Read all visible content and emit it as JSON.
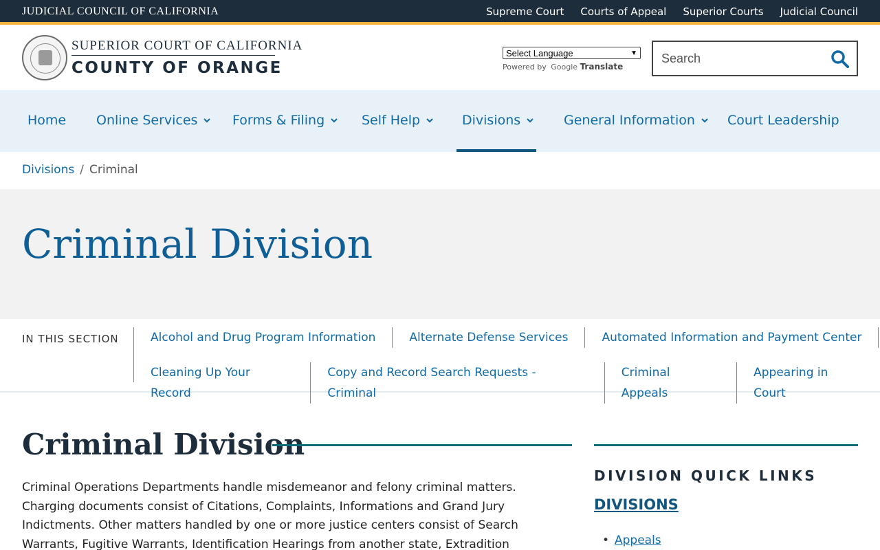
{
  "topbar": {
    "title": "JUDICIAL COUNCIL OF CALIFORNIA",
    "links": [
      "Supreme Court",
      "Courts of Appeal",
      "Superior Courts",
      "Judicial Council"
    ]
  },
  "header": {
    "brand_top": "SUPERIOR COURT OF CALIFORNIA",
    "brand_bottom": "COUNTY OF ORANGE",
    "language_select": "Select Language",
    "powered_by": "Powered by",
    "google": "Google",
    "translate": "Translate",
    "search_placeholder": "Search"
  },
  "nav": {
    "items": [
      {
        "label": "Home"
      },
      {
        "label": "Online Services"
      },
      {
        "label": "Forms & Filing"
      },
      {
        "label": "Self Help"
      },
      {
        "label": "Divisions"
      },
      {
        "label": "General Information"
      },
      {
        "label": "Court Leadership"
      }
    ],
    "active": "Divisions"
  },
  "breadcrumb": {
    "parent": "Divisions",
    "separator": "/",
    "current": "Criminal"
  },
  "hero": {
    "title": "Criminal Division"
  },
  "in_this_section": {
    "label": "IN THIS SECTION",
    "row1": [
      "Alcohol and Drug Program Information",
      "Alternate Defense Services",
      "Automated Information and Payment Center"
    ],
    "row2": [
      "Cleaning Up Your Record",
      "Copy and Record Search Requests - Criminal",
      "Criminal Appeals",
      "Appearing in Court"
    ]
  },
  "content": {
    "title": "Criminal Division",
    "paragraph": "Criminal Operations Departments handle misdemeanor and felony criminal matters. Charging documents consist of Citations, Complaints, Informations and Grand Jury Indictments. Other matters handled by one or more justice centers consist of Search Warrants, Fugitive Warrants, Identification Hearings from another state, Extradition Proceedings, Governor’s Warrants and Probable Cause Arrest Warrants."
  },
  "sidebar": {
    "heading": "DIVISION QUICK LINKS",
    "divisions_link": "DIVISIONS",
    "items": [
      "Appeals"
    ]
  },
  "colors": {
    "topbar_bg": "#1e2d3b",
    "accent_gold": "#f2b43f",
    "link_blue": "#0f6aa5",
    "nav_bg": "#e9f1f8",
    "teal_rule": "#116a7b"
  }
}
